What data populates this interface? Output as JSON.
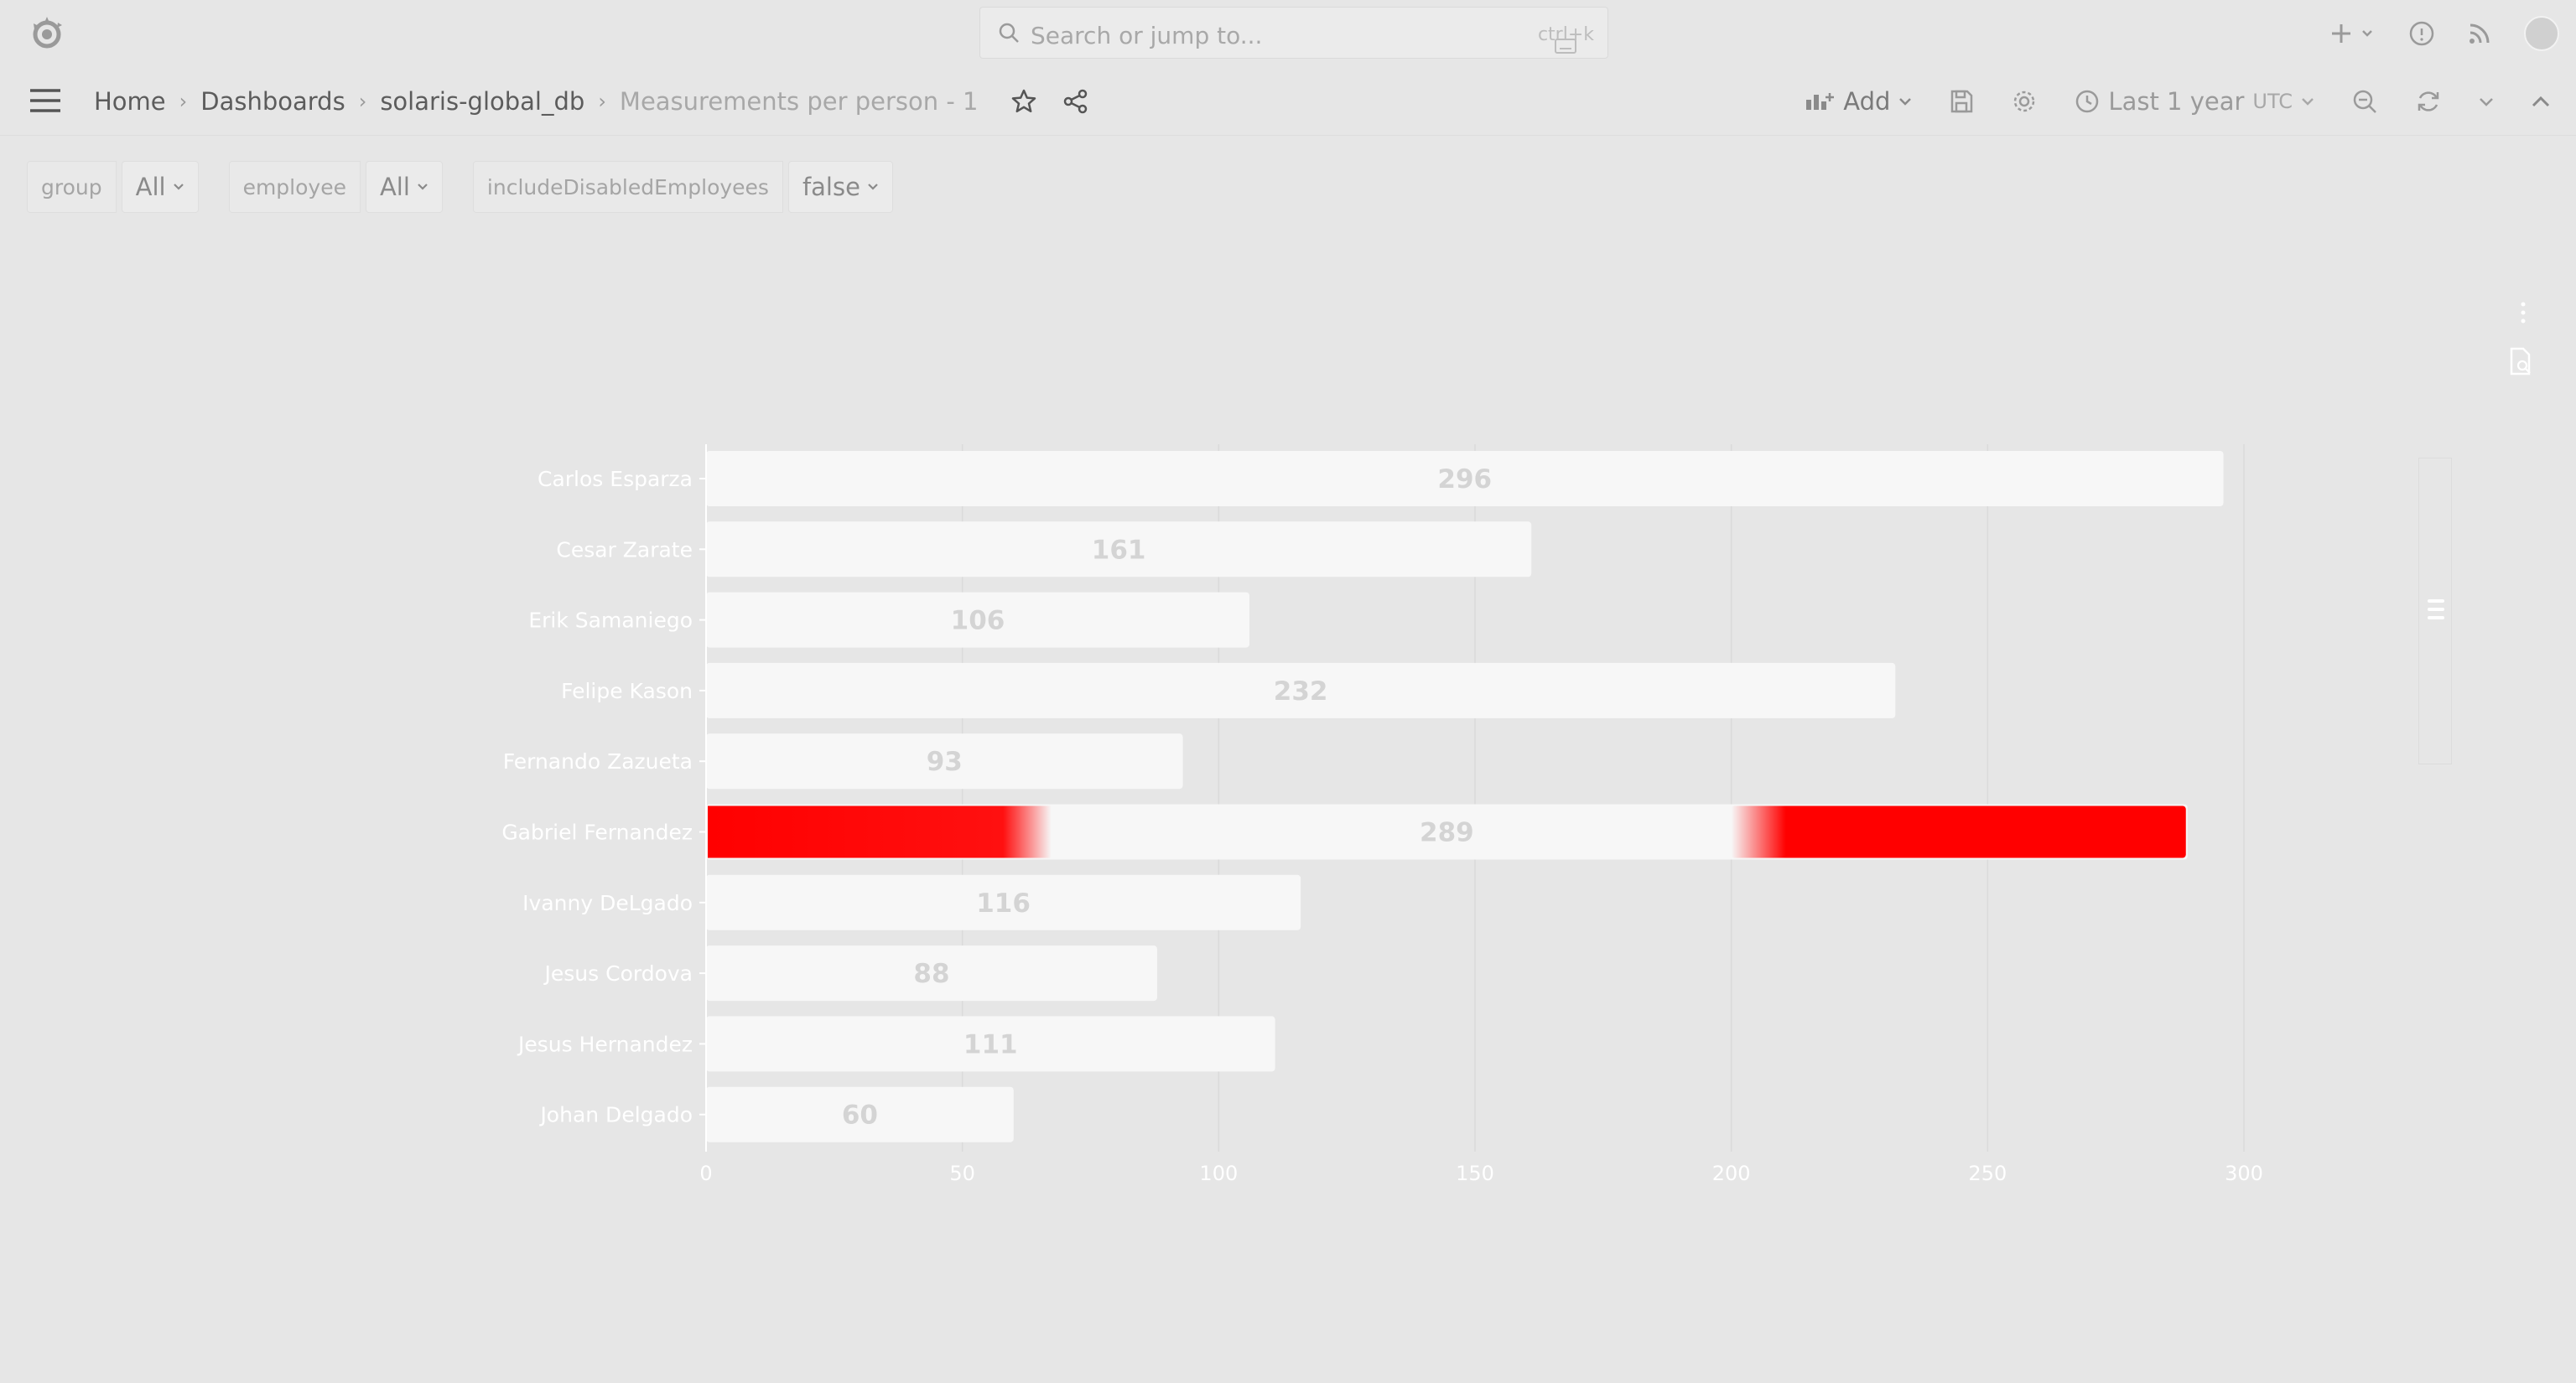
{
  "search": {
    "placeholder": "Search or jump to...",
    "shortcut": "ctrl+k"
  },
  "breadcrumb": {
    "home": "Home",
    "dashboards": "Dashboards",
    "folder": "solaris-global_db",
    "current": "Measurements per person - 1"
  },
  "toolbar": {
    "add_label": "Add",
    "time_range": "Last 1 year",
    "timezone": "UTC"
  },
  "variables": [
    {
      "label": "group",
      "value": "All"
    },
    {
      "label": "employee",
      "value": "All"
    },
    {
      "label": "includeDisabledEmployees",
      "value": "false"
    }
  ],
  "colors": {
    "bar": "#f7f7f7",
    "highlight": "#ff0000",
    "grid": "#dadada",
    "page_bg": "#e6e6e6"
  },
  "chart_data": {
    "type": "bar",
    "orientation": "horizontal",
    "categories": [
      "Carlos Esparza",
      "Cesar Zarate",
      "Erik Samaniego",
      "Felipe Kason",
      "Fernando Zazueta",
      "Gabriel Fernandez",
      "Ivanny DeLgado",
      "Jesus Cordova",
      "Jesus Hernandez",
      "Johan Delgado"
    ],
    "values": [
      296,
      161,
      106,
      232,
      93,
      289,
      116,
      88,
      111,
      60
    ],
    "xlim": [
      0,
      300
    ],
    "xticks": [
      0,
      50,
      100,
      150,
      200,
      250,
      300
    ],
    "grid": true,
    "highlighted_category": "Gabriel Fernandez"
  }
}
